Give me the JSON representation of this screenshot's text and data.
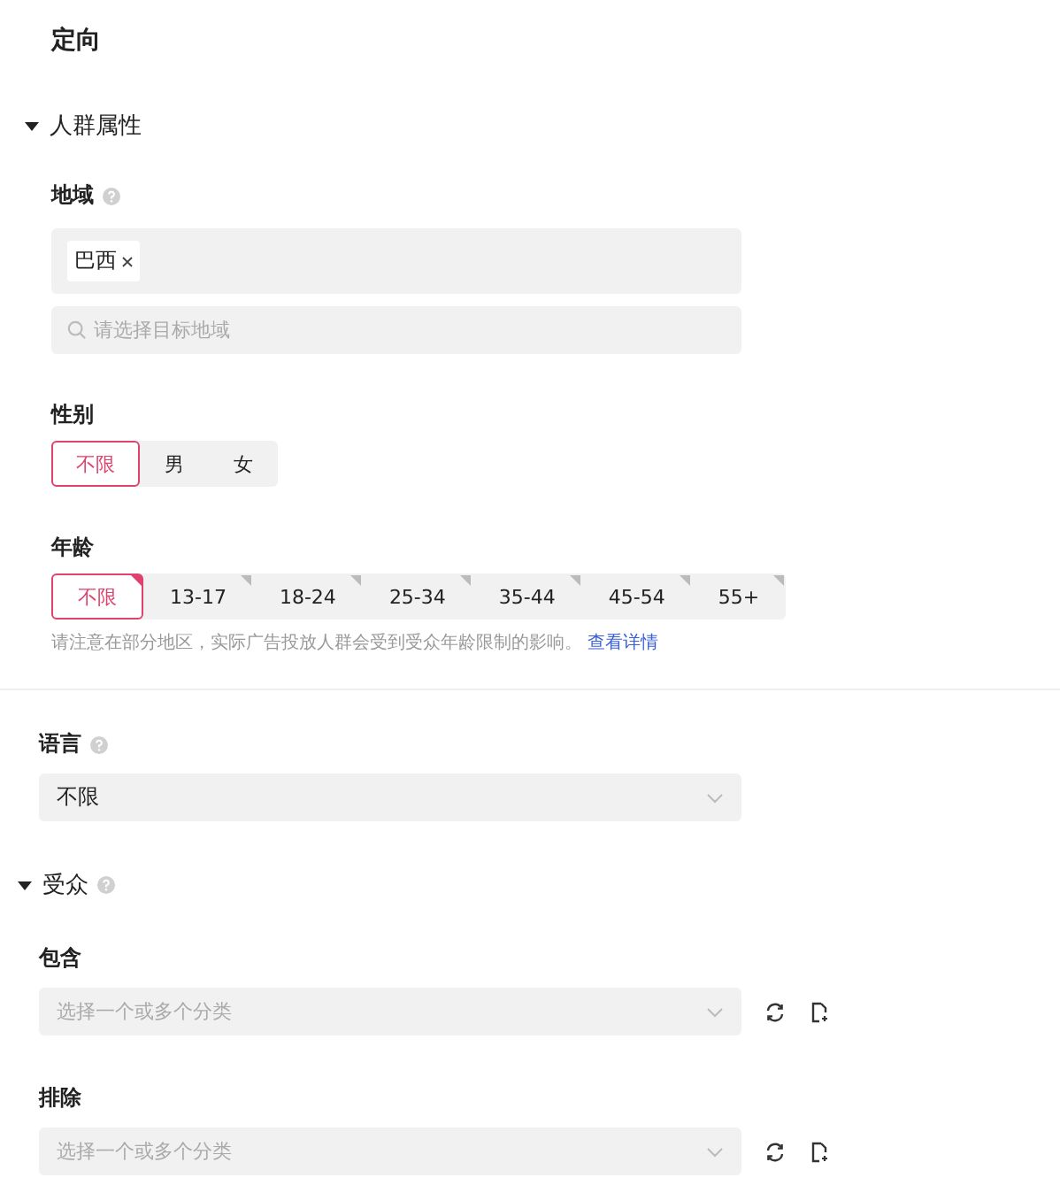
{
  "title": "定向",
  "audience_attributes": {
    "label": "人群属性",
    "expanded": true,
    "region": {
      "label": "地域",
      "tags": [
        "巴西"
      ],
      "placeholder": "请选择目标地域"
    },
    "gender": {
      "label": "性别",
      "options": [
        {
          "label": "不限",
          "selected": true
        },
        {
          "label": "男",
          "selected": false
        },
        {
          "label": "女",
          "selected": false
        }
      ]
    },
    "age": {
      "label": "年龄",
      "options": [
        {
          "label": "不限",
          "selected": true
        },
        {
          "label": "13-17",
          "selected": false
        },
        {
          "label": "18-24",
          "selected": false
        },
        {
          "label": "25-34",
          "selected": false
        },
        {
          "label": "35-44",
          "selected": false
        },
        {
          "label": "45-54",
          "selected": false
        },
        {
          "label": "55+",
          "selected": false
        }
      ],
      "note": "请注意在部分地区，实际广告投放人群会受到受众年龄限制的影响。",
      "link": "查看详情"
    }
  },
  "language": {
    "label": "语言",
    "value": "不限"
  },
  "audience": {
    "label": "受众",
    "expanded": true,
    "include": {
      "label": "包含",
      "placeholder": "选择一个或多个分类"
    },
    "exclude": {
      "label": "排除",
      "placeholder": "选择一个或多个分类"
    }
  }
}
